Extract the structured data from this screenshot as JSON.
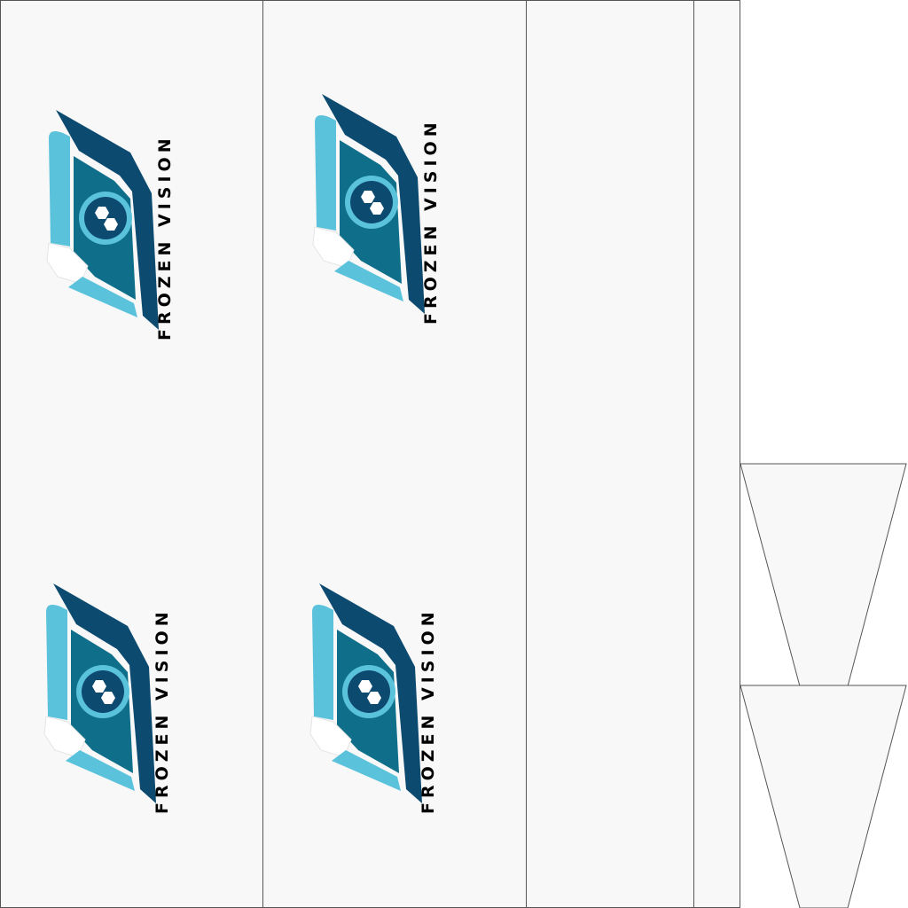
{
  "brand": {
    "name": "FROZEN VISION"
  },
  "colors": {
    "page_background": "#ffffff",
    "panel_fill": "#f8f8f8",
    "panel_border": "#555555",
    "logo_dark_blue": "#0d4a70",
    "logo_teal": "#0f6f8a",
    "logo_light_blue": "#5bc2dc",
    "logo_white": "#ffffff",
    "wordmark": "#000000"
  },
  "panels": [
    {
      "label": ""
    },
    {
      "label": ""
    },
    {
      "label": ""
    },
    {
      "label": ""
    }
  ],
  "logos": [
    {
      "icon": "frozen-vision-logo-icon"
    },
    {
      "icon": "frozen-vision-logo-icon"
    },
    {
      "icon": "frozen-vision-logo-icon"
    },
    {
      "icon": "frozen-vision-logo-icon"
    }
  ],
  "flags": [
    {
      "shape": "trapezoid-pennant"
    },
    {
      "shape": "trapezoid-pennant"
    }
  ]
}
